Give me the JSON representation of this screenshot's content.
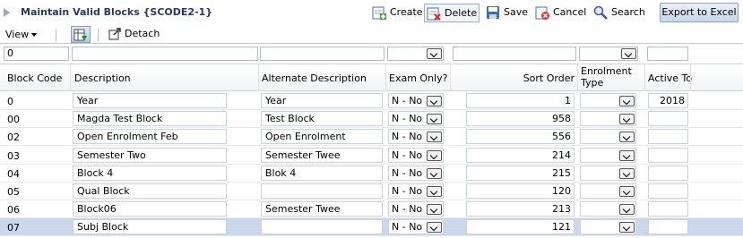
{
  "header": {
    "title": "Maintain Valid Blocks {SCODE2-1}",
    "actions": {
      "create": "Create",
      "delete": "Delete",
      "save": "Save",
      "cancel": "Cancel",
      "search": "Search",
      "export": "Export to Excel"
    }
  },
  "toolbar": {
    "view_label": "View",
    "detach_label": "Detach"
  },
  "filters": {
    "block_code": "0",
    "description": "",
    "alternate_description": "",
    "exam_only": "",
    "sort_order": "",
    "enrolment_type": "",
    "active_to": ""
  },
  "columns": {
    "block_code": "Block Code",
    "description": "Description",
    "alternate_description": "Alternate Description",
    "exam_only": "Exam Only?",
    "sort_order": "Sort Order",
    "enrolment_type": "Enrolment Type",
    "active_to": "Active To"
  },
  "rows": [
    {
      "code": "0",
      "description": "Year",
      "alt": "Year",
      "exam": "N - No",
      "sort": "1",
      "enrol": "",
      "active_to": "2018"
    },
    {
      "code": "00",
      "description": "Magda Test Block",
      "alt": "Test Block",
      "exam": "N - No",
      "sort": "958",
      "enrol": "",
      "active_to": ""
    },
    {
      "code": "02",
      "description": "Open Enrolment Feb",
      "alt": "Open Enrolment",
      "exam": "N - No",
      "sort": "556",
      "enrol": "",
      "active_to": ""
    },
    {
      "code": "03",
      "description": "Semester Two",
      "alt": "Semester Twee",
      "exam": "N - No",
      "sort": "214",
      "enrol": "",
      "active_to": ""
    },
    {
      "code": "04",
      "description": "Block 4",
      "alt": "Blok 4",
      "exam": "N - No",
      "sort": "215",
      "enrol": "",
      "active_to": ""
    },
    {
      "code": "05",
      "description": "Qual Block",
      "alt": "",
      "exam": "N - No",
      "sort": "120",
      "enrol": "",
      "active_to": ""
    },
    {
      "code": "06",
      "description": "Block06",
      "alt": "Semester Twee",
      "exam": "N - No",
      "sort": "213",
      "enrol": "",
      "active_to": ""
    },
    {
      "code": "07",
      "description": "Subj Block",
      "alt": "",
      "exam": "N - No",
      "sort": "121",
      "enrol": "",
      "active_to": ""
    }
  ],
  "selected_row_index": 7
}
